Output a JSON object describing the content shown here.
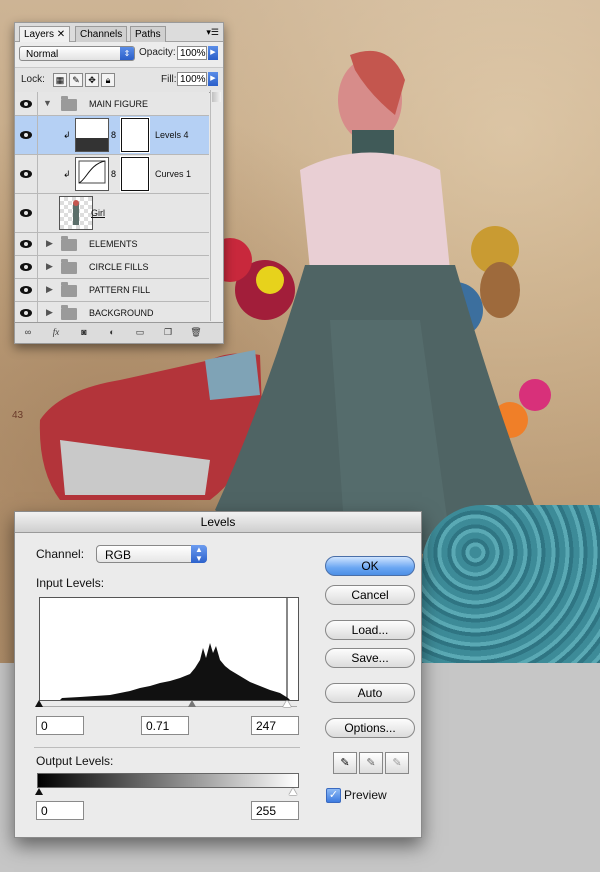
{
  "layers_panel": {
    "tabs": [
      "Layers",
      "Channels",
      "Paths"
    ],
    "blend_mode": "Normal",
    "opacity_label": "Opacity:",
    "opacity_value": "100%",
    "lock_label": "Lock:",
    "fill_label": "Fill:",
    "fill_value": "100%",
    "layers": [
      {
        "name": "MAIN FIGURE",
        "kind": "group",
        "expanded": true
      },
      {
        "name": "Levels 4",
        "kind": "adjustment",
        "selected": true
      },
      {
        "name": "Curves 1",
        "kind": "adjustment"
      },
      {
        "name": "Girl",
        "kind": "image"
      },
      {
        "name": "ELEMENTS",
        "kind": "group"
      },
      {
        "name": "CIRCLE FILLS",
        "kind": "group"
      },
      {
        "name": "PATTERN FILL",
        "kind": "group"
      },
      {
        "name": "BACKGROUND",
        "kind": "group"
      }
    ],
    "bottom_icons": [
      "link-icon",
      "fx-icon",
      "mask-icon",
      "adjustment-icon",
      "folder-icon",
      "new-layer-icon",
      "trash-icon"
    ]
  },
  "artwork": {
    "label": "43"
  },
  "levels_dialog": {
    "title": "Levels",
    "channel_label": "Channel:",
    "channel_value": "RGB",
    "input_levels_label": "Input Levels:",
    "input_black": "0",
    "input_gamma": "0.71",
    "input_white": "247",
    "output_levels_label": "Output Levels:",
    "output_black": "0",
    "output_white": "255",
    "buttons": {
      "ok": "OK",
      "cancel": "Cancel",
      "load": "Load...",
      "save": "Save...",
      "auto": "Auto",
      "options": "Options..."
    },
    "preview_label": "Preview",
    "preview_checked": true
  },
  "colors": {
    "selection": "#b5d0f4",
    "default_button": "#6aa6f2",
    "pattern": "#3d8b98"
  }
}
